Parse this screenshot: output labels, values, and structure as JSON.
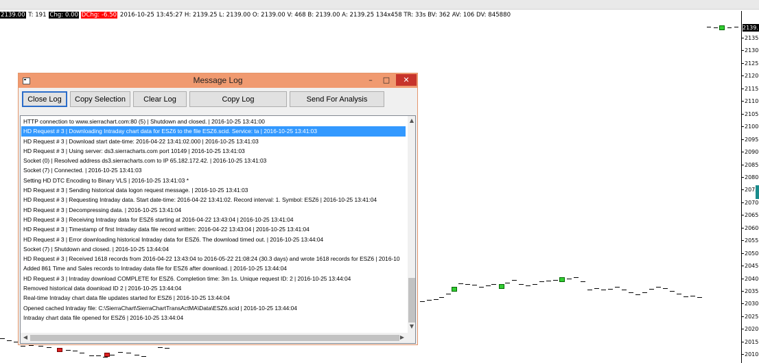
{
  "status_line": {
    "last_price": "2139.00",
    "trades": "T: 191",
    "chg": "Chg: 0.00",
    "dchg": "DChg: -6.50",
    "rest": "2016-10-25  13:45:27 H: 2139.25 L: 2139.00 O: 2139.00 V: 468 B: 2139.00 A: 2139.25 134x458 TR: 33s BV: 362 AV: 106 DV: 845880"
  },
  "price_scale": {
    "current_price_label": "2139.",
    "ticks": [
      "2135.",
      "2130.",
      "2125.",
      "2120.",
      "2115.",
      "2110.",
      "2105.",
      "2100.",
      "2095.",
      "2090.",
      "2085.",
      "2080.",
      "2075.",
      "2070.",
      "2065.",
      "2060.",
      "2055.",
      "2050.",
      "2045.",
      "2040.",
      "2035.",
      "2030.",
      "2025.",
      "2020.",
      "2015.",
      "2010."
    ]
  },
  "message_log": {
    "title": "Message Log",
    "buttons": {
      "close_log": "Close Log",
      "copy_selection": "Copy Selection",
      "clear_log": "Clear Log",
      "copy_log": "Copy Log",
      "send_for_analysis": "Send For Analysis"
    },
    "selected_index": 1,
    "lines": [
      "HTTP connection to www.sierrachart.com:80 (5) | Shutdown and closed. | 2016-10-25  13:41:00",
      "HD Request # 3 | Downloading Intraday chart data for ESZ6 to the file ESZ6.scid. Service: ta | 2016-10-25  13:41:03",
      "HD Request # 3 | Download start date-time: 2016-04-22  13:41:02.000 | 2016-10-25  13:41:03",
      "HD Request # 3 | Using server: ds3.sierracharts.com port 10149 | 2016-10-25  13:41:03",
      "Socket (0) | Resolved address ds3.sierracharts.com to IP 65.182.172.42. | 2016-10-25  13:41:03",
      "Socket (7) | Connected. | 2016-10-25  13:41:03",
      "Setting HD DTC Encoding to Binary VLS | 2016-10-25  13:41:03 *",
      "HD Request # 3 | Sending historical data logon request message. | 2016-10-25  13:41:03",
      "HD Request # 3 | Requesting Intraday data.  Start date-time: 2016-04-22  13:41:02.  Record interval:  1. Symbol: ESZ6 | 2016-10-25  13:41:04",
      "HD Request # 3 | Decompressing data. | 2016-10-25  13:41:04",
      "HD Request # 3 | Receiving Intraday data for ESZ6 starting at 2016-04-22  13:43:04 | 2016-10-25  13:41:04",
      "HD Request # 3 | Timestamp of first Intraday data file record written: 2016-04-22  13:43:04 | 2016-10-25  13:41:04",
      "HD Request # 3 | Error downloading historical Intraday data for ESZ6.  The download timed out. | 2016-10-25  13:44:04",
      "Socket (7) | Shutdown and closed. | 2016-10-25  13:44:04",
      "HD Request # 3 | Received 1618 records from 2016-04-22  13:43:04 to 2016-05-22  21:08:24 (30.3 days) and wrote 1618 records for ESZ6 | 2016-10",
      "Added 861 Time and Sales records to Intraday data file for ESZ6 after download. | 2016-10-25  13:44:04",
      "HD Request # 3 | Intraday download COMPLETE for ESZ6. Completion time: 3m 1s. Unique request ID: 2 | 2016-10-25  13:44:04",
      "Removed historical data download ID 2 | 2016-10-25  13:44:04",
      "Real-time Intraday chart data file updates started for ESZ6 | 2016-10-25  13:44:04",
      "Opened cached Intraday file: C:\\SierraChart\\SierraChartTransActMA\\Data\\ESZ6.scid | 2016-10-25  13:44:04",
      "Intraday chart data file opened for ESZ6 | 2016-10-25  13:44:04"
    ]
  },
  "colors": {
    "title_bar": "#f09a70",
    "selection": "#3399ff",
    "close_button": "#c7342b",
    "bar_up": "#33cc33",
    "bar_down": "#dd2222"
  }
}
